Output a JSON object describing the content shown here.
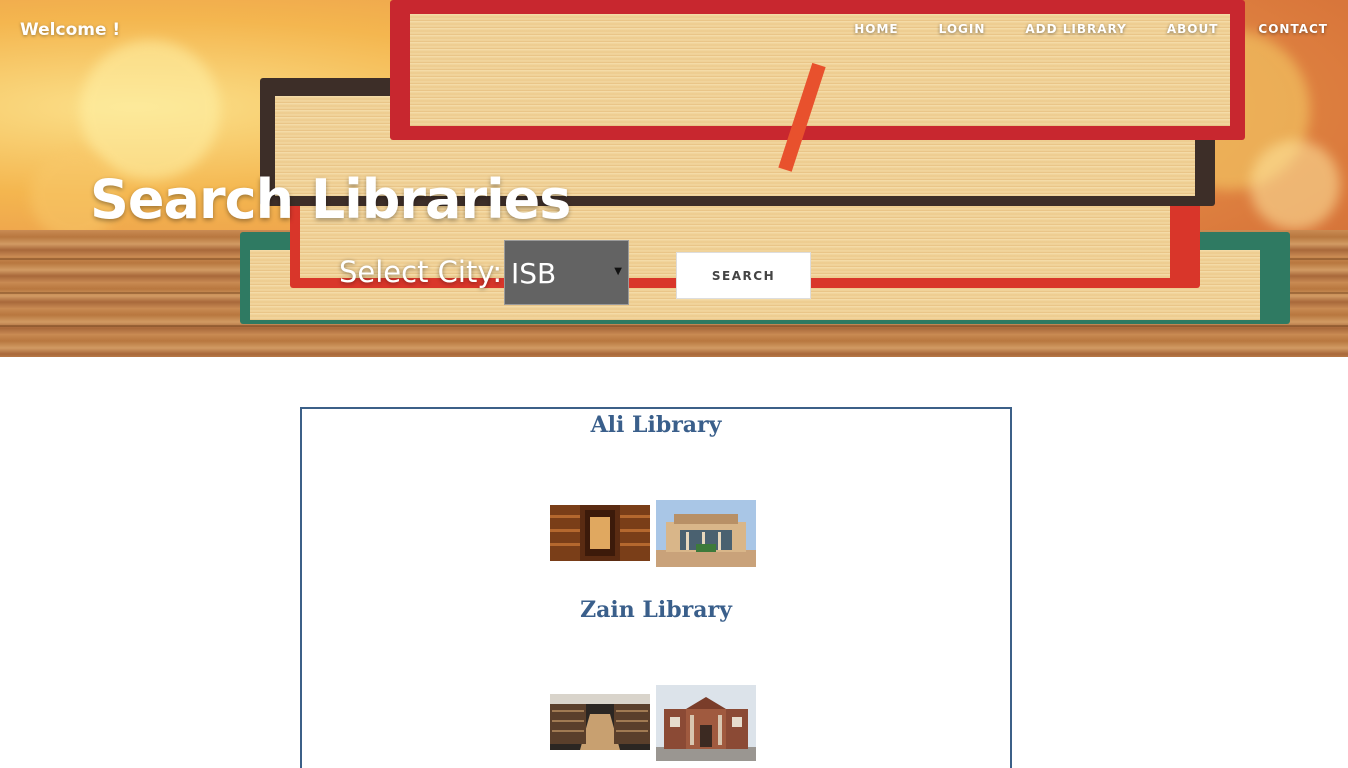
{
  "header": {
    "brand": "Welcome !",
    "nav": [
      "HOME",
      "LOGIN",
      "ADD LIBRARY",
      "ABOUT",
      "CONTACT"
    ]
  },
  "hero": {
    "title": "Search Libraries",
    "city_label": "Select City:",
    "city_value": "ISB",
    "search_label": "SEARCH"
  },
  "libraries": [
    {
      "name": "Ali Library"
    },
    {
      "name": "Zain Library"
    }
  ],
  "colors": {
    "accent": "#3a5f8b",
    "select_bg": "#636363"
  }
}
